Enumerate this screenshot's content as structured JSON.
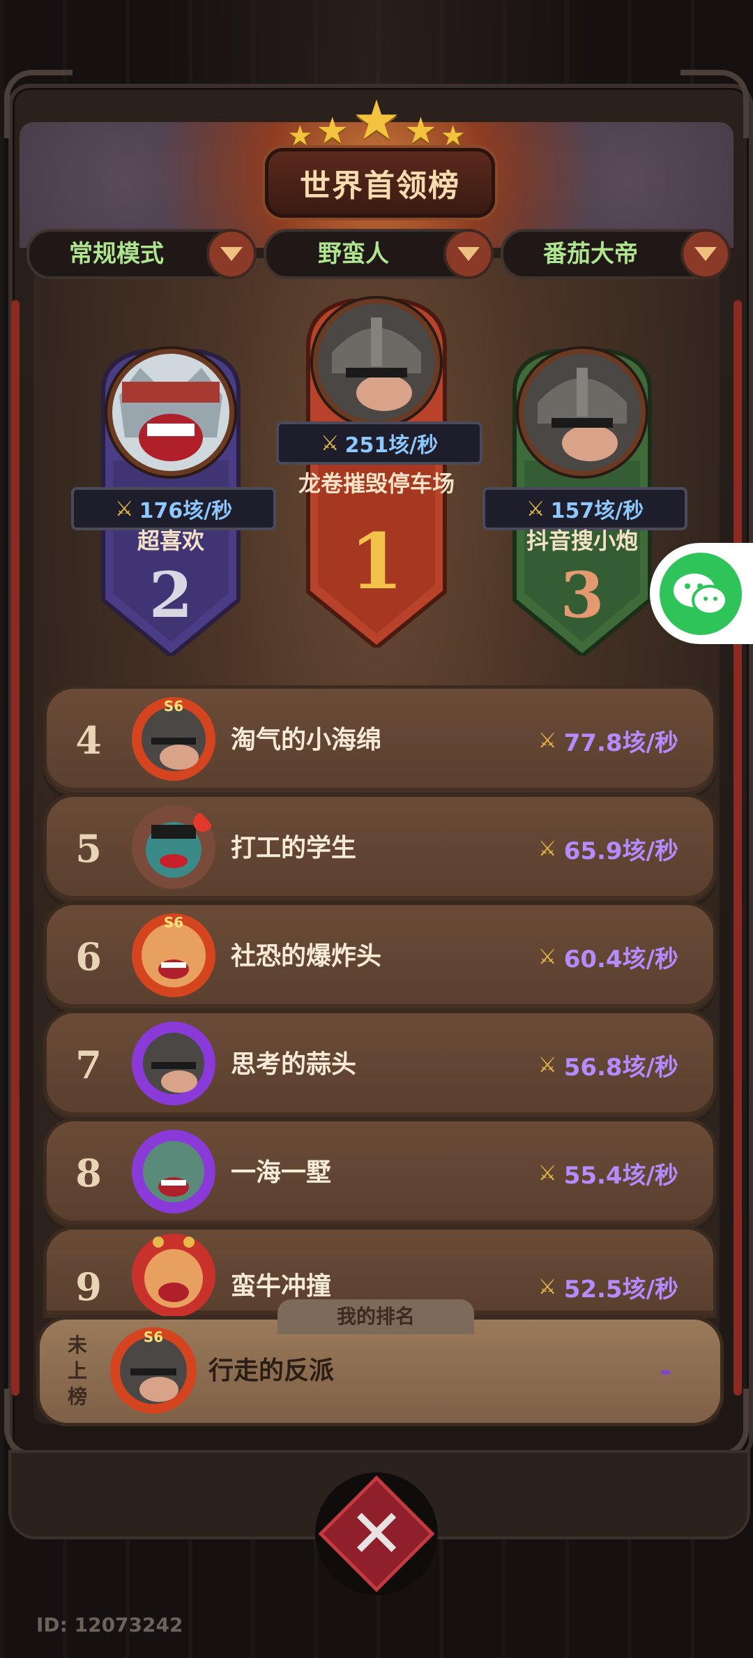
{
  "title": "世界首领榜",
  "filters": [
    {
      "label": "常规模式"
    },
    {
      "label": "野蛮人"
    },
    {
      "label": "番茄大帝"
    }
  ],
  "podium": {
    "first": {
      "rank": "1",
      "name": "龙卷摧毁停车场",
      "score": "251垓/秒"
    },
    "second": {
      "rank": "2",
      "name": "超喜欢",
      "score": "176垓/秒"
    },
    "third": {
      "rank": "3",
      "name": "抖音搜小炮",
      "score": "157垓/秒"
    }
  },
  "leaderboard": [
    {
      "rank": "4",
      "name": "淘气的小海绵",
      "score": "77.8垓/秒"
    },
    {
      "rank": "5",
      "name": "打工的学生",
      "score": "65.9垓/秒"
    },
    {
      "rank": "6",
      "name": "社恐的爆炸头",
      "score": "60.4垓/秒"
    },
    {
      "rank": "7",
      "name": "思考的蒜头",
      "score": "56.8垓/秒"
    },
    {
      "rank": "8",
      "name": "一海一墅",
      "score": "55.4垓/秒"
    },
    {
      "rank": "9",
      "name": "蛮牛冲撞",
      "score": "52.5垓/秒"
    }
  ],
  "my_rank": {
    "tab_label": "我的排名",
    "status": "未上榜",
    "name": "行走的反派",
    "score": "-"
  },
  "user_id": "ID: 12073242",
  "icons": {
    "score": "crossed-swords-icon",
    "close": "close-x-icon",
    "share": "wechat-icon",
    "badge_text": "S6"
  },
  "colors": {
    "first": "#b8422a",
    "second": "#4b3c86",
    "third": "#3f6a3a",
    "score_text": "#b58cff",
    "podium_score": "#8ec8ff",
    "filter_text": "#aee58e"
  }
}
